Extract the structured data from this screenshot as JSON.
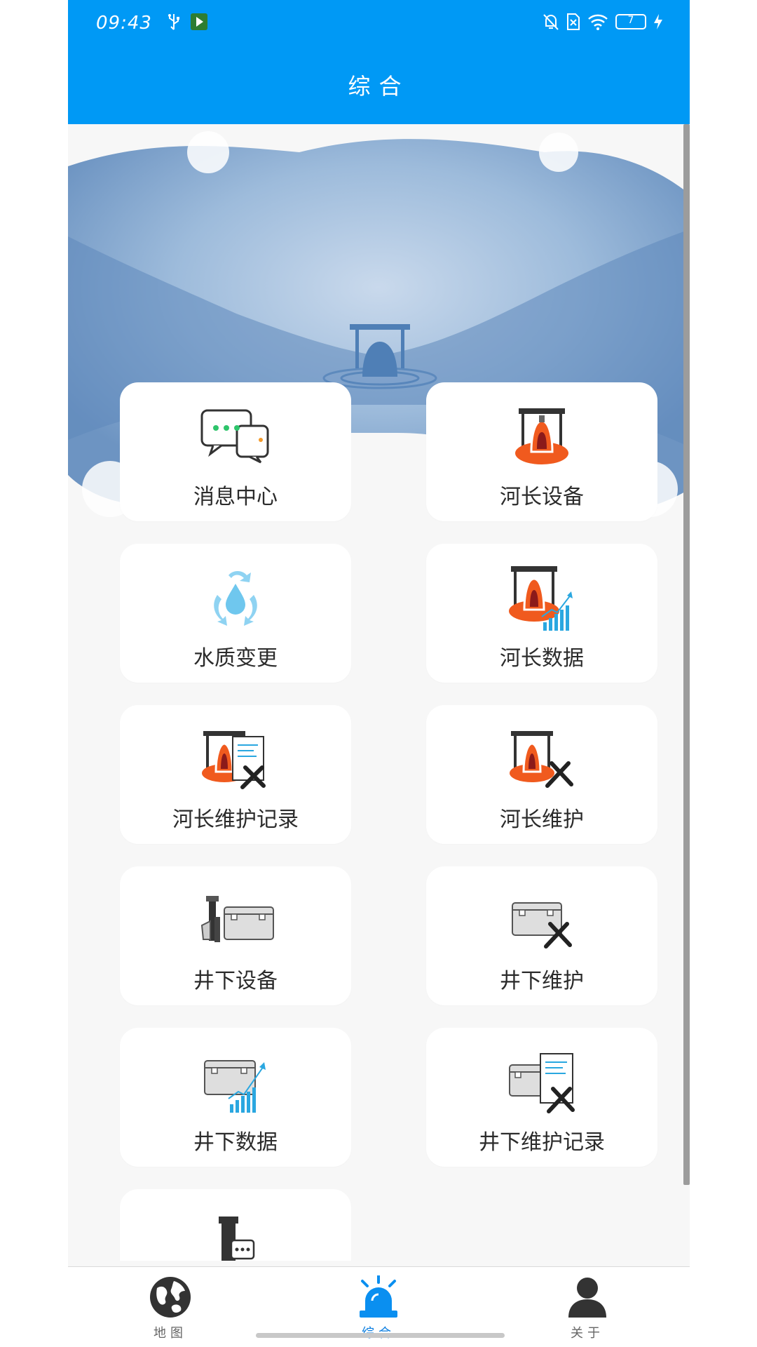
{
  "status_bar": {
    "time": "09:43",
    "battery": "7"
  },
  "header": {
    "title": "综合"
  },
  "menu": {
    "items": [
      {
        "label": "消息中心",
        "icon": "message-center-icon"
      },
      {
        "label": "河长设备",
        "icon": "buoy-device-icon"
      },
      {
        "label": "水质变更",
        "icon": "water-quality-icon"
      },
      {
        "label": "河长数据",
        "icon": "buoy-data-icon"
      },
      {
        "label": "河长维护记录",
        "icon": "buoy-maintenance-record-icon"
      },
      {
        "label": "河长维护",
        "icon": "buoy-maintenance-icon"
      },
      {
        "label": "井下设备",
        "icon": "well-device-icon"
      },
      {
        "label": "井下维护",
        "icon": "well-maintenance-icon"
      },
      {
        "label": "井下数据",
        "icon": "well-data-icon"
      },
      {
        "label": "井下维护记录",
        "icon": "well-maintenance-record-icon"
      },
      {
        "label": "",
        "icon": "device-message-icon"
      }
    ]
  },
  "bottom_nav": {
    "items": [
      {
        "label": "地图",
        "icon": "globe-icon",
        "active": false
      },
      {
        "label": "综合",
        "icon": "alarm-light-icon",
        "active": true
      },
      {
        "label": "关于",
        "icon": "person-icon",
        "active": false
      }
    ]
  },
  "colors": {
    "header": "#0099f5",
    "buoy_orange": "#f05a1e",
    "accent_blue": "#2aa7e0"
  }
}
